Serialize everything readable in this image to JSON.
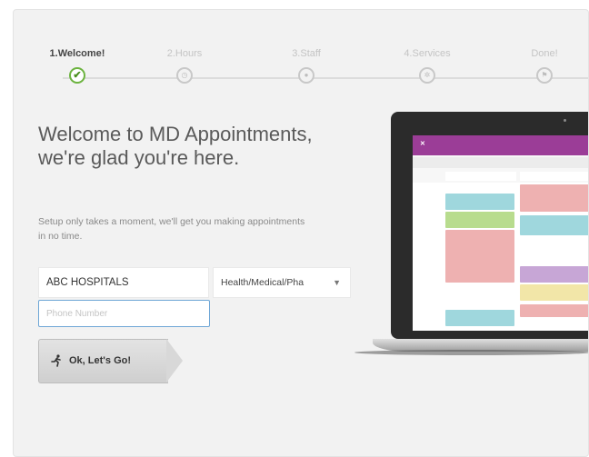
{
  "steps": [
    {
      "label": "1.Welcome!",
      "icon": "check-icon",
      "active": true
    },
    {
      "label": "2.Hours",
      "icon": "clock-icon",
      "active": false
    },
    {
      "label": "3.Staff",
      "icon": "person-icon",
      "active": false
    },
    {
      "label": "4.Services",
      "icon": "gear-icon",
      "active": false
    },
    {
      "label": "Done!",
      "icon": "flag-icon",
      "active": false
    }
  ],
  "welcome": {
    "headline": "Welcome to MD Appointments, we're glad you're here.",
    "subtext": "Setup only takes a moment, we'll get you making appointments in no time."
  },
  "form": {
    "organization_value": "ABC HOSPITALS",
    "category_value": "Health/Medical/Pha",
    "phone_placeholder": "Phone Number",
    "submit_label": "Ok, Let's Go!"
  },
  "colors": {
    "active_step": "#6cb33f",
    "app_header": "#9b3d97",
    "input_focus": "#6fa7d6"
  }
}
